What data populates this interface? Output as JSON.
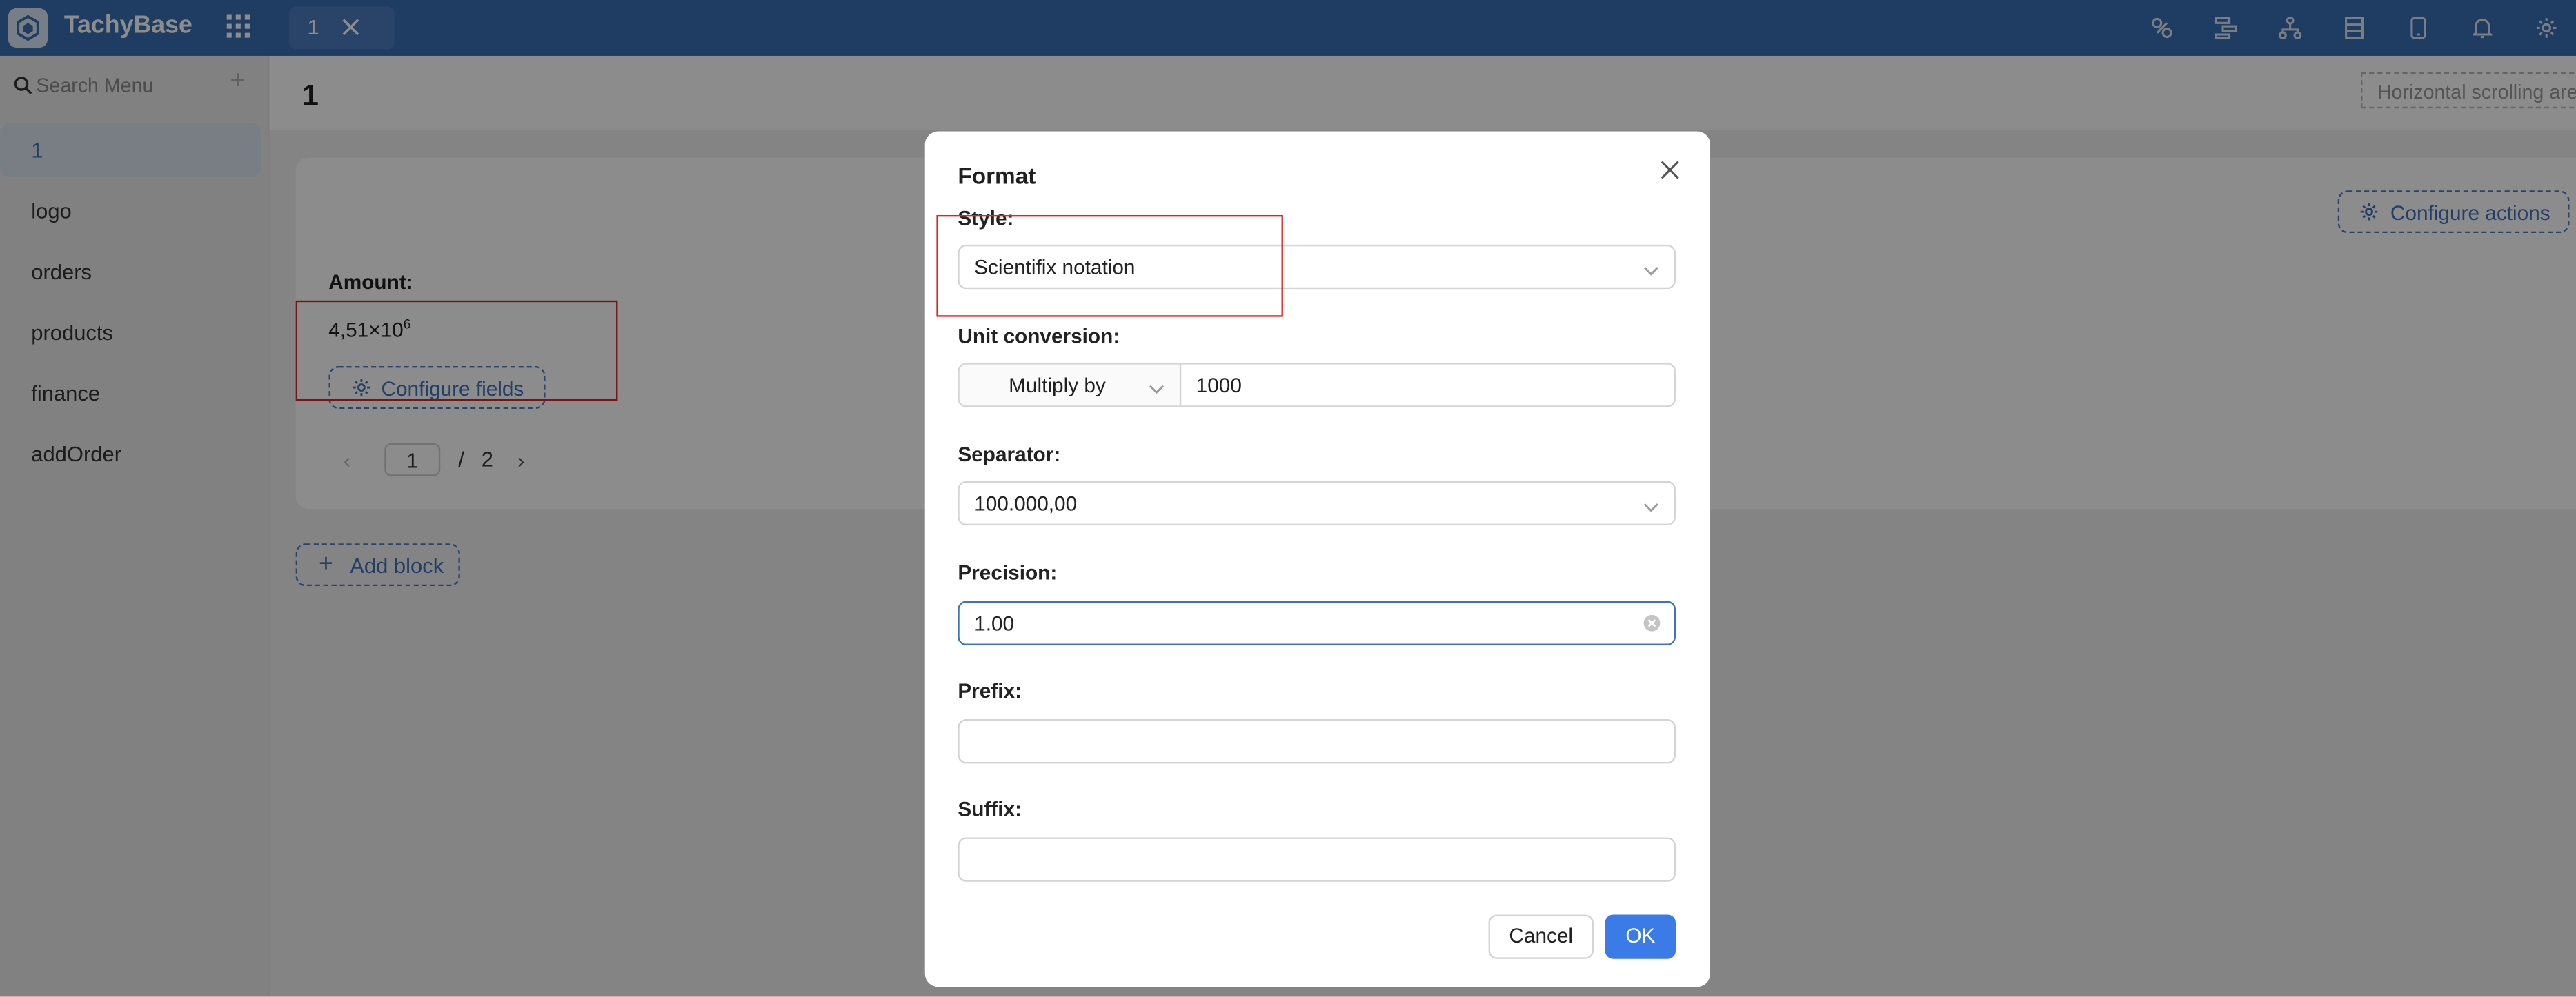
{
  "app": {
    "brand": "TachyBase",
    "tab_label": "1",
    "top_icons": [
      "paint-icon",
      "workflow-icon",
      "org-chart-icon",
      "database-icon",
      "mobile-icon",
      "bell-icon",
      "gear-icon"
    ]
  },
  "sidebar": {
    "search_placeholder": "Search Menu",
    "add_symbol": "+",
    "items": [
      {
        "label": "1"
      },
      {
        "label": "logo"
      },
      {
        "label": "orders"
      },
      {
        "label": "products"
      },
      {
        "label": "finance"
      },
      {
        "label": "addOrder"
      }
    ]
  },
  "page": {
    "title": "1",
    "horizontal_scrolling": "Horizontal scrolling are",
    "configure_actions": "Configure actions",
    "amount_label": "Amount",
    "amount_mantissa": "4,51×10",
    "amount_exponent": "6",
    "configure_fields": "Configure fields",
    "pager": {
      "current": "1",
      "slash": "/",
      "total": "2",
      "prev": "‹",
      "next": "›"
    },
    "add_block": "Add block",
    "add_block_symbol": "+"
  },
  "modal": {
    "title": "Format",
    "style_label": "Style",
    "style_value": "Scientifix notation",
    "unit_label": "Unit conversion",
    "unit_mode": "Multiply by",
    "unit_value": "1000",
    "separator_label": "Separator",
    "separator_value": "100.000,00",
    "precision_label": "Precision",
    "precision_value": "1.00",
    "prefix_label": "Prefix",
    "prefix_value": "",
    "suffix_label": "Suffix",
    "suffix_value": "",
    "cancel_label": "Cancel",
    "ok_label": "OK",
    "colon": ":"
  },
  "colors": {
    "topbar": "#3a6eb2",
    "primary": "#3b7be8",
    "link": "#3f74bd",
    "highlight": "#e02424"
  }
}
